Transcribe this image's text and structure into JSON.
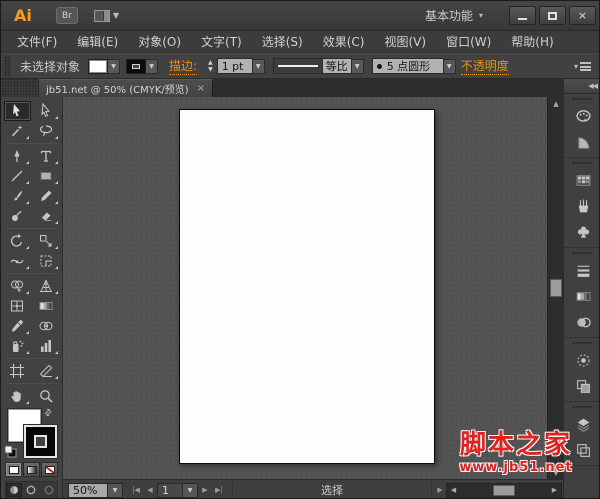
{
  "titlebar": {
    "logo": "Ai",
    "bridge": "Br",
    "workspace": "基本功能"
  },
  "menubar": {
    "items": [
      "文件(F)",
      "编辑(E)",
      "对象(O)",
      "文字(T)",
      "选择(S)",
      "效果(C)",
      "视图(V)",
      "窗口(W)",
      "帮助(H)"
    ]
  },
  "controlbar": {
    "no_selection": "未选择对象",
    "stroke_label": "描边:",
    "stroke_width": "1 pt",
    "profile_label": "等比",
    "brush_label": "5 点圆形",
    "opacity_label": "不透明度"
  },
  "tab": {
    "title": "jb51.net @ 50% (CMYK/预览)",
    "close": "×"
  },
  "toolbar": {
    "selected_tool": "selection",
    "groups": [
      [
        "selection",
        "direct-selection",
        "magic-wand",
        "lasso"
      ],
      [
        "pen",
        "type",
        "line-segment",
        "rectangle",
        "paintbrush",
        "pencil",
        "blob-brush",
        "eraser"
      ],
      [
        "rotate",
        "scale",
        "width",
        "free-transform"
      ],
      [
        "shape-builder",
        "perspective-grid",
        "mesh",
        "gradient",
        "eyedropper",
        "blend",
        "symbol-sprayer",
        "column-graph"
      ],
      [
        "artboard",
        "slice"
      ],
      [
        "hand",
        "zoom"
      ]
    ]
  },
  "panelstrip": {
    "groups": [
      [
        "color",
        "color-guide"
      ],
      [
        "swatches",
        "brushes",
        "symbols"
      ],
      [
        "stroke",
        "gradient",
        "transparency"
      ],
      [
        "appearance",
        "graphic-styles"
      ],
      [
        "layers",
        "artboards"
      ]
    ]
  },
  "statusbar": {
    "zoom_value": "50%",
    "artboard_number": "1",
    "status_text": "选择"
  },
  "watermark": {
    "title": "脚本之家",
    "url": "www.jb51.net"
  },
  "colors": {
    "accent_orange": "#e8930a",
    "watermark_red": "#dd2222",
    "canvas_gray": "#525252",
    "artboard_white": "#fdfdfd"
  }
}
